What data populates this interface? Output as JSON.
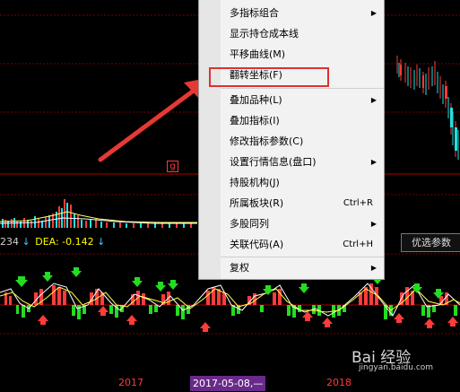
{
  "context_menu": {
    "items": [
      {
        "label": "多指标组合",
        "shortcut": "",
        "submenu": true
      },
      {
        "label": "显示持仓成本线",
        "shortcut": "",
        "submenu": false
      },
      {
        "label": "平移曲线(M)",
        "shortcut": "",
        "submenu": false
      },
      {
        "label": "翻转坐标(F)",
        "shortcut": "",
        "submenu": false
      },
      {
        "label": "叠加品种(L)",
        "shortcut": "",
        "submenu": true
      },
      {
        "label": "叠加指标(I)",
        "shortcut": "",
        "submenu": false
      },
      {
        "label": "修改指标参数(C)",
        "shortcut": "",
        "submenu": false
      },
      {
        "label": "设置行情信息(盘口)",
        "shortcut": "",
        "submenu": true
      },
      {
        "label": "持股机构(J)",
        "shortcut": "",
        "submenu": false
      },
      {
        "label": "所属板块(R)",
        "shortcut": "Ctrl+R",
        "submenu": false
      },
      {
        "label": "多股同列",
        "shortcut": "",
        "submenu": true
      },
      {
        "label": "关联代码(A)",
        "shortcut": "Ctrl+H",
        "submenu": false
      },
      {
        "label": "复权",
        "shortcut": "",
        "submenu": true
      }
    ],
    "highlighted_item": "翻转坐标(F)"
  },
  "indicator": {
    "left_value": "234",
    "dea_label": "DEA: -0.142",
    "dea_color": "#ffff00"
  },
  "youxuan_button": "优选参数",
  "chart_marker": "g",
  "time_axis": {
    "label_2017": "2017",
    "selected_date": "2017-05-08,—",
    "label_2018": "2018"
  },
  "watermark": {
    "brand": "Bai 经验",
    "url": "jingyan.baidu.com"
  },
  "colors": {
    "up": "#ff3b3b",
    "down": "#22dd22",
    "highlight_box": "#e03030",
    "menu_bg": "#f2f2f2"
  }
}
